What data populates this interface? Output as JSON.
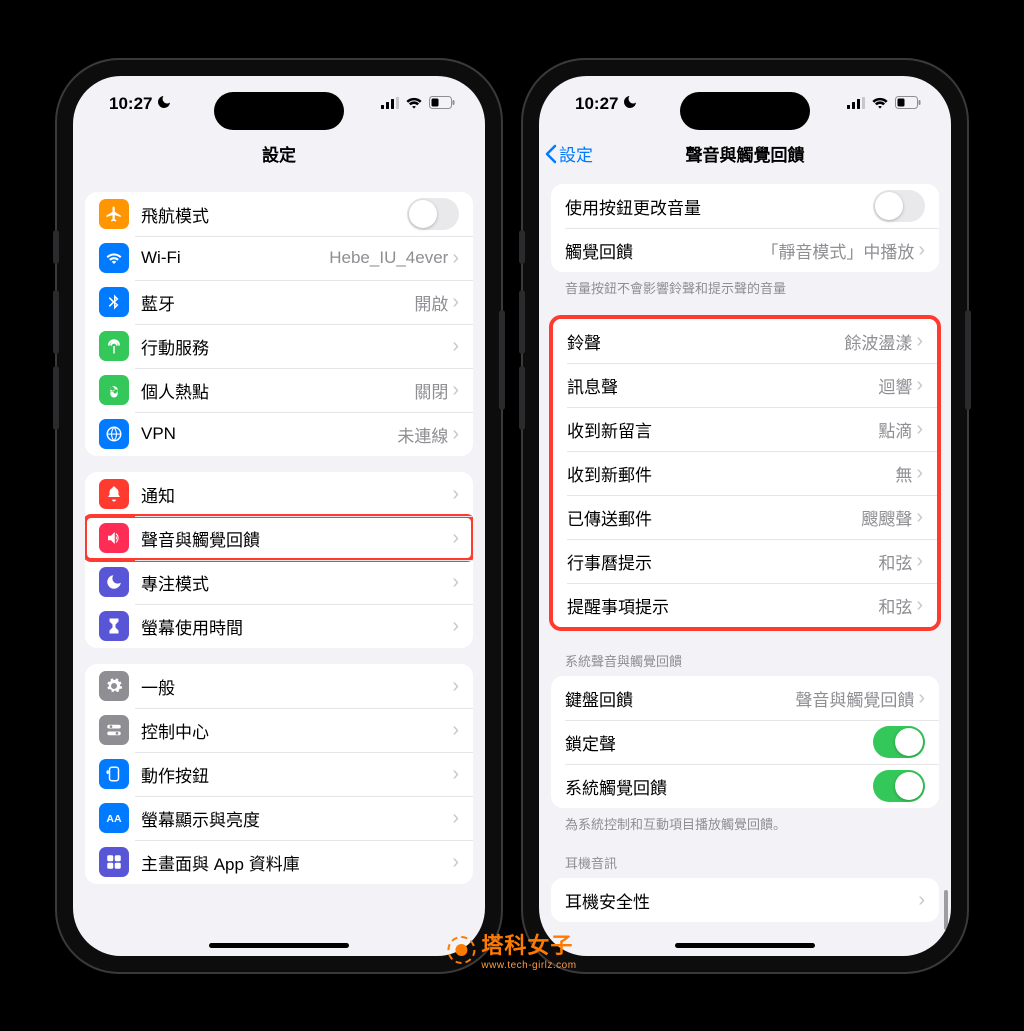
{
  "status": {
    "time": "10:27"
  },
  "watermark": {
    "text": "塔科女子",
    "sub": "www.tech-girlz.com"
  },
  "left": {
    "title": "設定",
    "groups": [
      {
        "rows": [
          {
            "icon": "airplane",
            "bg": "#ff9500",
            "label": "飛航模式",
            "toggle": "off"
          },
          {
            "icon": "wifi",
            "bg": "#007aff",
            "label": "Wi-Fi",
            "value": "Hebe_IU_4ever"
          },
          {
            "icon": "bluetooth",
            "bg": "#007aff",
            "label": "藍牙",
            "value": "開啟"
          },
          {
            "icon": "cellular",
            "bg": "#34c759",
            "label": "行動服務"
          },
          {
            "icon": "hotspot",
            "bg": "#34c759",
            "label": "個人熱點",
            "value": "關閉"
          },
          {
            "icon": "vpn",
            "bg": "#007aff",
            "label": "VPN",
            "value": "未連線"
          }
        ]
      },
      {
        "rows": [
          {
            "icon": "bell",
            "bg": "#ff3b30",
            "label": "通知"
          },
          {
            "icon": "speaker",
            "bg": "#ff2d55",
            "label": "聲音與觸覺回饋",
            "highlight": true
          },
          {
            "icon": "moon",
            "bg": "#5856d6",
            "label": "專注模式"
          },
          {
            "icon": "hourglass",
            "bg": "#5856d6",
            "label": "螢幕使用時間"
          }
        ]
      },
      {
        "rows": [
          {
            "icon": "gear",
            "bg": "#8e8e93",
            "label": "一般"
          },
          {
            "icon": "switches",
            "bg": "#8e8e93",
            "label": "控制中心"
          },
          {
            "icon": "action",
            "bg": "#007aff",
            "label": "動作按鈕"
          },
          {
            "icon": "display",
            "bg": "#007aff",
            "label": "螢幕顯示與亮度"
          },
          {
            "icon": "apps",
            "bg": "#5856d6",
            "label": "主畫面與 App 資料庫"
          }
        ]
      }
    ]
  },
  "right": {
    "back": "設定",
    "title": "聲音與觸覺回饋",
    "top_rows": [
      {
        "label": "使用按鈕更改音量",
        "toggle": "off"
      },
      {
        "label": "觸覺回饋",
        "value": "「靜音模式」中播放"
      }
    ],
    "caption1": "音量按鈕不會影響鈴聲和提示聲的音量",
    "sounds": [
      {
        "label": "鈴聲",
        "value": "餘波盪漾"
      },
      {
        "label": "訊息聲",
        "value": "迴響"
      },
      {
        "label": "收到新留言",
        "value": "點滴"
      },
      {
        "label": "收到新郵件",
        "value": "無"
      },
      {
        "label": "已傳送郵件",
        "value": "颼颼聲"
      },
      {
        "label": "行事曆提示",
        "value": "和弦"
      },
      {
        "label": "提醒事項提示",
        "value": "和弦"
      }
    ],
    "section2_title": "系統聲音與觸覺回饋",
    "system_rows": [
      {
        "label": "鍵盤回饋",
        "value": "聲音與觸覺回饋"
      },
      {
        "label": "鎖定聲",
        "toggle": "on"
      },
      {
        "label": "系統觸覺回饋",
        "toggle": "on"
      }
    ],
    "caption2": "為系統控制和互動項目播放觸覺回饋。",
    "section3_title": "耳機音訊",
    "headphone_rows": [
      {
        "label": "耳機安全性"
      }
    ]
  }
}
